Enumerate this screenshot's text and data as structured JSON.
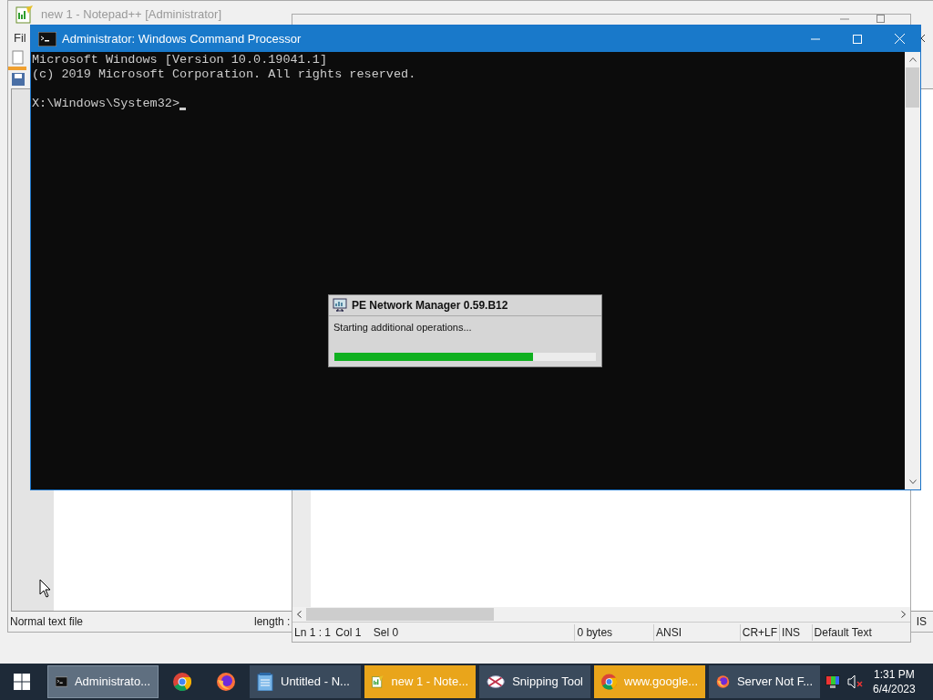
{
  "notepadpp": {
    "title": "new 1 - Notepad++ [Administrator]",
    "menu": [
      "Fil"
    ],
    "status": [
      "Normal text file",
      "length :",
      "IS"
    ]
  },
  "editor": {
    "status": [
      "Ln 1 : 1",
      "Col 1",
      "Sel 0",
      "0 bytes",
      "ANSI",
      "CR+LF",
      "INS",
      "Default Text"
    ]
  },
  "console": {
    "title": "Administrator: Windows Command Processor",
    "lines": [
      "Microsoft Windows [Version 10.0.19041.1]",
      "(c) 2019 Microsoft Corporation. All rights reserved."
    ],
    "prompt": "X:\\Windows\\System32>"
  },
  "dialog": {
    "title": "PE Network Manager 0.59.B12",
    "message": "Starting additional operations...",
    "level": 0.76
  },
  "taskbar": {
    "items": [
      {
        "kind": "console",
        "label": "Administrato...",
        "selected": true,
        "flashing": false
      },
      {
        "kind": "chrome",
        "selected": false,
        "flashing": false
      },
      {
        "kind": "firefox",
        "selected": false,
        "flashing": false
      },
      {
        "kind": "notepad",
        "label": "Untitled - N...",
        "selected": false,
        "flashing": false
      },
      {
        "kind": "notepadpp",
        "label": "new 1 - Note...",
        "selected": false,
        "flashing": true
      },
      {
        "kind": "snip",
        "label": "Snipping Tool",
        "selected": false,
        "flashing": false
      },
      {
        "kind": "chrome",
        "label": "www.google...",
        "selected": false,
        "flashing": true
      },
      {
        "kind": "firefox",
        "label": "Server Not F...",
        "selected": false,
        "flashing": false
      }
    ],
    "muted": true,
    "time": "1:31 PM",
    "date": "6/4/2023"
  }
}
